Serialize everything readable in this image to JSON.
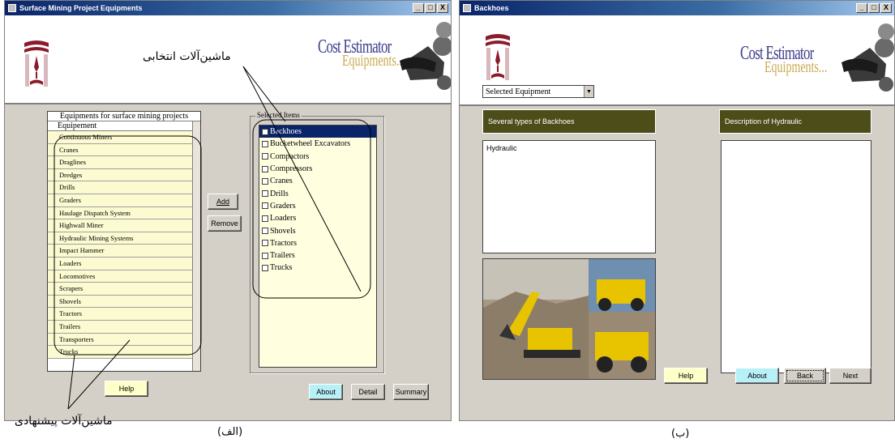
{
  "left_window": {
    "title": "Surface Mining Project Equipments",
    "title_buttons": [
      "_",
      "□",
      "X"
    ],
    "brand": {
      "line1": "Cost Estimator",
      "line2": "Equipments..."
    },
    "grid_caption": "Equipments for surface mining projects",
    "grid_header": "Equipement",
    "equipment_list": [
      "Continuous Miners",
      "Cranes",
      "Draglines",
      "Dredges",
      "Drills",
      "Graders",
      "Haulage Dispatch System",
      "Highwall Miner",
      "Hydraulic Mining Systems",
      "Impact Hammer",
      "Loaders",
      "Locomotives",
      "Scrapers",
      "Shovels",
      "Tractors",
      "Trailers",
      "Transporters",
      "Trucks"
    ],
    "add_label": "Add",
    "remove_label": "Remove",
    "selected_legend": "Selected Items",
    "selected_items": [
      {
        "label": "Backhoes",
        "checked": true,
        "selected": true
      },
      {
        "label": "Bucketwheel Excavators",
        "checked": false,
        "selected": false
      },
      {
        "label": "Compactors",
        "checked": false,
        "selected": false
      },
      {
        "label": "Compressors",
        "checked": false,
        "selected": false
      },
      {
        "label": "Cranes",
        "checked": false,
        "selected": false
      },
      {
        "label": "Drills",
        "checked": false,
        "selected": false
      },
      {
        "label": "Graders",
        "checked": false,
        "selected": false
      },
      {
        "label": "Loaders",
        "checked": false,
        "selected": false
      },
      {
        "label": "Shovels",
        "checked": false,
        "selected": false
      },
      {
        "label": "Tractors",
        "checked": false,
        "selected": false
      },
      {
        "label": "Trailers",
        "checked": false,
        "selected": false
      },
      {
        "label": "Trucks",
        "checked": false,
        "selected": false
      }
    ],
    "help_label": "Help",
    "about_label": "About",
    "detail_label": "Detail",
    "summary_label": "Summary"
  },
  "right_window": {
    "title": "Backhoes",
    "title_buttons": [
      "_",
      "□",
      "X"
    ],
    "brand": {
      "line1": "Cost Estimator",
      "line2": "Equipments..."
    },
    "dropdown_value": "Selected Equipment",
    "types_header": "Several types of Backhoes",
    "types_items": [
      "Hydraulic"
    ],
    "description_header": "Description of  Hydraulic",
    "help_label": "Help",
    "about_label": "About",
    "back_label": "Back",
    "next_label": "Next"
  },
  "annotations": {
    "selected_machines": "ماشین‌آلات انتخابی",
    "suggested_machines": "ماشین‌آلات پیشنهادی",
    "caption_left": "(الف)",
    "caption_right": "(ب)"
  },
  "colors": {
    "titlebar": "#0a246a",
    "panel_header": "#4d4d19",
    "list_bg": "#fbfad0",
    "window_bg": "#d4d0c8"
  }
}
